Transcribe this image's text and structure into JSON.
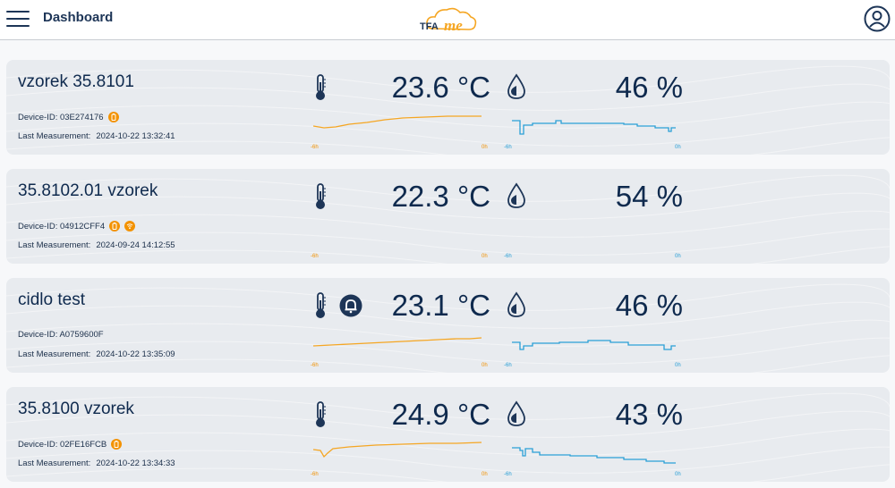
{
  "header": {
    "title": "Dashboard",
    "logo_text": "TFA",
    "logo_script": "me"
  },
  "devices": [
    {
      "name": "vzorek 35.8101",
      "device_id_label": "Device-ID: 03E274176",
      "last_measurement_label": "Last Measurement:",
      "last_measurement": "2024-10-22 13:32:41",
      "temperature": "23.6 °C",
      "humidity": "46 %",
      "badges": [
        "battery-icon"
      ],
      "alarm": false,
      "temp_axis": [
        "-6h",
        "0h"
      ],
      "hum_axis": [
        "-6h",
        "0h"
      ]
    },
    {
      "name": "35.8102.01 vzorek",
      "device_id_label": "Device-ID: 04912CFF4",
      "last_measurement_label": "Last Measurement:",
      "last_measurement": "2024-09-24 14:12:55",
      "temperature": "22.3 °C",
      "humidity": "54 %",
      "badges": [
        "battery-icon",
        "signal-icon"
      ],
      "alarm": false,
      "temp_axis": [
        "-6h",
        "0h"
      ],
      "hum_axis": [
        "-6h",
        "0h"
      ]
    },
    {
      "name": "cidlo test",
      "device_id_label": "Device-ID: A0759600F",
      "last_measurement_label": "Last Measurement:",
      "last_measurement": "2024-10-22 13:35:09",
      "temperature": "23.1 °C",
      "humidity": "46 %",
      "badges": [],
      "alarm": true,
      "temp_axis": [
        "-6h",
        "0h"
      ],
      "hum_axis": [
        "-6h",
        "0h"
      ]
    },
    {
      "name": "35.8100 vzorek",
      "device_id_label": "Device-ID: 02FE16FCB",
      "last_measurement_label": "Last Measurement:",
      "last_measurement": "2024-10-22 13:34:33",
      "temperature": "24.9 °C",
      "humidity": "43 %",
      "badges": [
        "battery-icon"
      ],
      "alarm": false,
      "temp_axis": [
        "-6h",
        "0h"
      ],
      "hum_axis": [
        "-6h",
        "0h"
      ]
    }
  ],
  "colors": {
    "navy": "#0f2a4e",
    "temperature_line": "#f5a623",
    "humidity_line": "#2a9fd6",
    "badge": "#f39200",
    "card_bg": "#e8ebef"
  }
}
